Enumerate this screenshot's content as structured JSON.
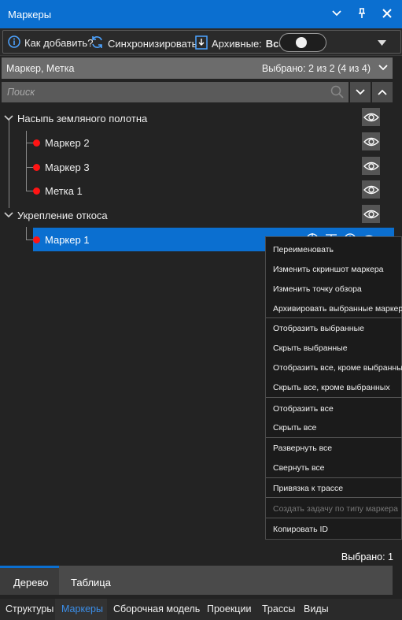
{
  "window": {
    "title": "Маркеры"
  },
  "toolbar": {
    "how_to_add": "Как добавить?",
    "sync": "Синхронизировать",
    "archived_label": "Архивные:",
    "archived_value": "Все"
  },
  "filter": {
    "fields": "Маркер, Метка",
    "selected_summary": "Выбрано: 2 из 2 (4 из 4)"
  },
  "search": {
    "placeholder": "Поиск"
  },
  "tree": {
    "groups": [
      {
        "label": "Насыпь земляного полотна",
        "items": [
          "Маркер 2",
          "Маркер 3",
          "Метка 1"
        ]
      },
      {
        "label": "Укрепление откоса",
        "items": [
          "Маркер 1"
        ]
      }
    ],
    "marker_color": "#ff1414"
  },
  "context_menu": {
    "items": [
      "Переименовать",
      "Изменить скриншот маркера",
      "Изменить точку обзора",
      "Архивировать выбранные маркеры",
      "Отобразить выбранные",
      "Скрыть выбранные",
      "Отобразить все, кроме выбранных",
      "Скрыть все, кроме выбранных",
      "Отобразить все",
      "Скрыть все",
      "Развернуть все",
      "Свернуть все",
      "Привязка к трассе",
      "Создать задачу по типу маркера",
      "Копировать ID"
    ],
    "disabled": [
      "Создать задачу по типу маркера"
    ]
  },
  "status": {
    "selected": "Выбрано: 1"
  },
  "view_tabs": [
    "Дерево",
    "Таблица"
  ],
  "main_tabs": [
    "Структуры",
    "Маркеры",
    "Сборочная модель",
    "Проекции",
    "Трассы",
    "Виды"
  ],
  "colors": {
    "accent": "#0b6fd0",
    "active_tab_text": "#3b8ee8"
  }
}
